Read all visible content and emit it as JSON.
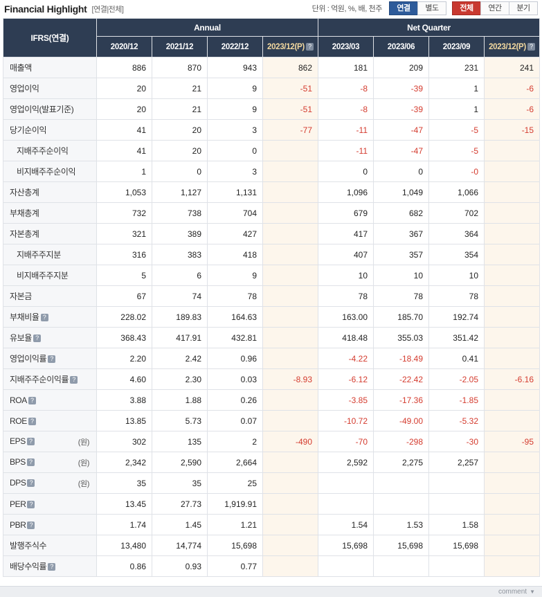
{
  "header": {
    "title": "Financial Highlight",
    "subtitle": "[연결|전체]",
    "unit_note": "단위 : 억원, %, 배, 천주",
    "toggles_1": [
      {
        "label": "연결",
        "active": true
      },
      {
        "label": "별도",
        "active": false
      }
    ],
    "toggles_2": [
      {
        "label": "전체",
        "active": true
      },
      {
        "label": "연간",
        "active": false
      },
      {
        "label": "분기",
        "active": false
      }
    ]
  },
  "table": {
    "corner_label": "IFRS(연결)",
    "group_annual": "Annual",
    "group_quarter": "Net Quarter",
    "columns": [
      "2020/12",
      "2021/12",
      "2022/12",
      "2023/12(P)",
      "2023/03",
      "2023/06",
      "2023/09",
      "2023/12(P)"
    ],
    "estimate_columns": [
      3,
      7
    ],
    "rows": [
      {
        "label": "매출액",
        "indent": false,
        "unit": "",
        "values": [
          "886",
          "870",
          "943",
          "862",
          "181",
          "209",
          "231",
          "241"
        ],
        "neg": [
          false,
          false,
          false,
          false,
          false,
          false,
          false,
          false
        ]
      },
      {
        "label": "영업이익",
        "indent": false,
        "unit": "",
        "values": [
          "20",
          "21",
          "9",
          "-51",
          "-8",
          "-39",
          "1",
          "-6"
        ],
        "neg": [
          false,
          false,
          false,
          true,
          true,
          true,
          false,
          true
        ]
      },
      {
        "label": "영업이익(발표기준)",
        "indent": false,
        "unit": "",
        "values": [
          "20",
          "21",
          "9",
          "-51",
          "-8",
          "-39",
          "1",
          "-6"
        ],
        "neg": [
          false,
          false,
          false,
          true,
          true,
          true,
          false,
          true
        ]
      },
      {
        "label": "당기순이익",
        "indent": false,
        "unit": "",
        "values": [
          "41",
          "20",
          "3",
          "-77",
          "-11",
          "-47",
          "-5",
          "-15"
        ],
        "neg": [
          false,
          false,
          false,
          true,
          true,
          true,
          true,
          true
        ]
      },
      {
        "label": "지배주주순이익",
        "indent": true,
        "unit": "",
        "values": [
          "41",
          "20",
          "0",
          "",
          "-11",
          "-47",
          "-5",
          ""
        ],
        "neg": [
          false,
          false,
          false,
          false,
          true,
          true,
          true,
          false
        ]
      },
      {
        "label": "비지배주주순이익",
        "indent": true,
        "unit": "",
        "values": [
          "1",
          "0",
          "3",
          "",
          "0",
          "0",
          "-0",
          ""
        ],
        "neg": [
          false,
          false,
          false,
          false,
          false,
          false,
          true,
          false
        ]
      },
      {
        "label": "자산총계",
        "indent": false,
        "unit": "",
        "values": [
          "1,053",
          "1,127",
          "1,131",
          "",
          "1,096",
          "1,049",
          "1,066",
          ""
        ],
        "neg": [
          false,
          false,
          false,
          false,
          false,
          false,
          false,
          false
        ]
      },
      {
        "label": "부채총계",
        "indent": false,
        "unit": "",
        "values": [
          "732",
          "738",
          "704",
          "",
          "679",
          "682",
          "702",
          ""
        ],
        "neg": [
          false,
          false,
          false,
          false,
          false,
          false,
          false,
          false
        ]
      },
      {
        "label": "자본총계",
        "indent": false,
        "unit": "",
        "values": [
          "321",
          "389",
          "427",
          "",
          "417",
          "367",
          "364",
          ""
        ],
        "neg": [
          false,
          false,
          false,
          false,
          false,
          false,
          false,
          false
        ]
      },
      {
        "label": "지배주주지분",
        "indent": true,
        "unit": "",
        "values": [
          "316",
          "383",
          "418",
          "",
          "407",
          "357",
          "354",
          ""
        ],
        "neg": [
          false,
          false,
          false,
          false,
          false,
          false,
          false,
          false
        ]
      },
      {
        "label": "비지배주주지분",
        "indent": true,
        "unit": "",
        "values": [
          "5",
          "6",
          "9",
          "",
          "10",
          "10",
          "10",
          ""
        ],
        "neg": [
          false,
          false,
          false,
          false,
          false,
          false,
          false,
          false
        ]
      },
      {
        "label": "자본금",
        "indent": false,
        "unit": "",
        "values": [
          "67",
          "74",
          "78",
          "",
          "78",
          "78",
          "78",
          ""
        ],
        "neg": [
          false,
          false,
          false,
          false,
          false,
          false,
          false,
          false
        ]
      },
      {
        "label": "부채비율",
        "indent": false,
        "unit": "",
        "help": true,
        "values": [
          "228.02",
          "189.83",
          "164.63",
          "",
          "163.00",
          "185.70",
          "192.74",
          ""
        ],
        "neg": [
          false,
          false,
          false,
          false,
          false,
          false,
          false,
          false
        ]
      },
      {
        "label": "유보율",
        "indent": false,
        "unit": "",
        "help": true,
        "values": [
          "368.43",
          "417.91",
          "432.81",
          "",
          "418.48",
          "355.03",
          "351.42",
          ""
        ],
        "neg": [
          false,
          false,
          false,
          false,
          false,
          false,
          false,
          false
        ]
      },
      {
        "label": "영업이익률",
        "indent": false,
        "unit": "",
        "help": true,
        "values": [
          "2.20",
          "2.42",
          "0.96",
          "",
          "-4.22",
          "-18.49",
          "0.41",
          ""
        ],
        "neg": [
          false,
          false,
          false,
          false,
          true,
          true,
          false,
          false
        ]
      },
      {
        "label": "지배주주순이익률",
        "indent": false,
        "unit": "",
        "help": true,
        "values": [
          "4.60",
          "2.30",
          "0.03",
          "-8.93",
          "-6.12",
          "-22.42",
          "-2.05",
          "-6.16"
        ],
        "neg": [
          false,
          false,
          false,
          true,
          true,
          true,
          true,
          true
        ]
      },
      {
        "label": "ROA",
        "indent": false,
        "unit": "",
        "help": true,
        "values": [
          "3.88",
          "1.88",
          "0.26",
          "",
          "-3.85",
          "-17.36",
          "-1.85",
          ""
        ],
        "neg": [
          false,
          false,
          false,
          false,
          true,
          true,
          true,
          false
        ]
      },
      {
        "label": "ROE",
        "indent": false,
        "unit": "",
        "help": true,
        "values": [
          "13.85",
          "5.73",
          "0.07",
          "",
          "-10.72",
          "-49.00",
          "-5.32",
          ""
        ],
        "neg": [
          false,
          false,
          false,
          false,
          true,
          true,
          true,
          false
        ]
      },
      {
        "label": "EPS",
        "indent": false,
        "unit": "(원)",
        "help": true,
        "values": [
          "302",
          "135",
          "2",
          "-490",
          "-70",
          "-298",
          "-30",
          "-95"
        ],
        "neg": [
          false,
          false,
          false,
          true,
          true,
          true,
          true,
          true
        ]
      },
      {
        "label": "BPS",
        "indent": false,
        "unit": "(원)",
        "help": true,
        "values": [
          "2,342",
          "2,590",
          "2,664",
          "",
          "2,592",
          "2,275",
          "2,257",
          ""
        ],
        "neg": [
          false,
          false,
          false,
          false,
          false,
          false,
          false,
          false
        ]
      },
      {
        "label": "DPS",
        "indent": false,
        "unit": "(원)",
        "help": true,
        "values": [
          "35",
          "35",
          "25",
          "",
          "",
          "",
          "",
          ""
        ],
        "neg": [
          false,
          false,
          false,
          false,
          false,
          false,
          false,
          false
        ]
      },
      {
        "label": "PER",
        "indent": false,
        "unit": "",
        "help": true,
        "values": [
          "13.45",
          "27.73",
          "1,919.91",
          "",
          "",
          "",
          "",
          ""
        ],
        "neg": [
          false,
          false,
          false,
          false,
          false,
          false,
          false,
          false
        ]
      },
      {
        "label": "PBR",
        "indent": false,
        "unit": "",
        "help": true,
        "values": [
          "1.74",
          "1.45",
          "1.21",
          "",
          "1.54",
          "1.53",
          "1.58",
          ""
        ],
        "neg": [
          false,
          false,
          false,
          false,
          false,
          false,
          false,
          false
        ]
      },
      {
        "label": "발행주식수",
        "indent": false,
        "unit": "",
        "values": [
          "13,480",
          "14,774",
          "15,698",
          "",
          "15,698",
          "15,698",
          "15,698",
          ""
        ],
        "neg": [
          false,
          false,
          false,
          false,
          false,
          false,
          false,
          false
        ]
      },
      {
        "label": "배당수익률",
        "indent": false,
        "unit": "",
        "help": true,
        "values": [
          "0.86",
          "0.93",
          "0.77",
          "",
          "",
          "",
          "",
          ""
        ],
        "neg": [
          false,
          false,
          false,
          false,
          false,
          false,
          false,
          false
        ]
      }
    ]
  },
  "footer": {
    "comment_label": "comment"
  }
}
